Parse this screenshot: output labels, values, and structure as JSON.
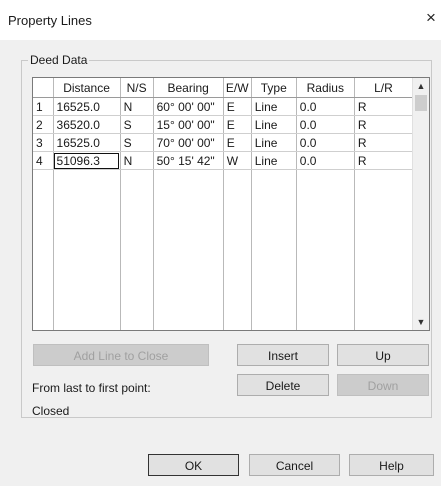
{
  "window": {
    "title": "Property Lines",
    "close_glyph": "×"
  },
  "deed": {
    "legend": "Deed Data",
    "columns": [
      "",
      "Distance",
      "N/S",
      "Bearing",
      "E/W",
      "Type",
      "Radius",
      "L/R"
    ],
    "rows": [
      {
        "idx": "1",
        "distance": "16525.0",
        "ns": "N",
        "bearing": "60° 00' 00\"",
        "ew": "E",
        "type": "Line",
        "radius": "0.0",
        "lr": "R"
      },
      {
        "idx": "2",
        "distance": "36520.0",
        "ns": "S",
        "bearing": "15° 00' 00\"",
        "ew": "E",
        "type": "Line",
        "radius": "0.0",
        "lr": "R"
      },
      {
        "idx": "3",
        "distance": "16525.0",
        "ns": "S",
        "bearing": "70° 00' 00\"",
        "ew": "E",
        "type": "Line",
        "radius": "0.0",
        "lr": "R"
      },
      {
        "idx": "4",
        "distance": "51096.3",
        "ns": "N",
        "bearing": "50° 15' 42\"",
        "ew": "W",
        "type": "Line",
        "radius": "0.0",
        "lr": "R"
      }
    ],
    "scroll_up_glyph": "▲",
    "scroll_down_glyph": "▼"
  },
  "buttons": {
    "add_line": "Add Line to Close",
    "insert": "Insert",
    "up": "Up",
    "delete": "Delete",
    "down": "Down",
    "ok": "OK",
    "cancel": "Cancel",
    "help": "Help"
  },
  "status": {
    "from_last": "From last to first point:",
    "closed": "Closed"
  }
}
